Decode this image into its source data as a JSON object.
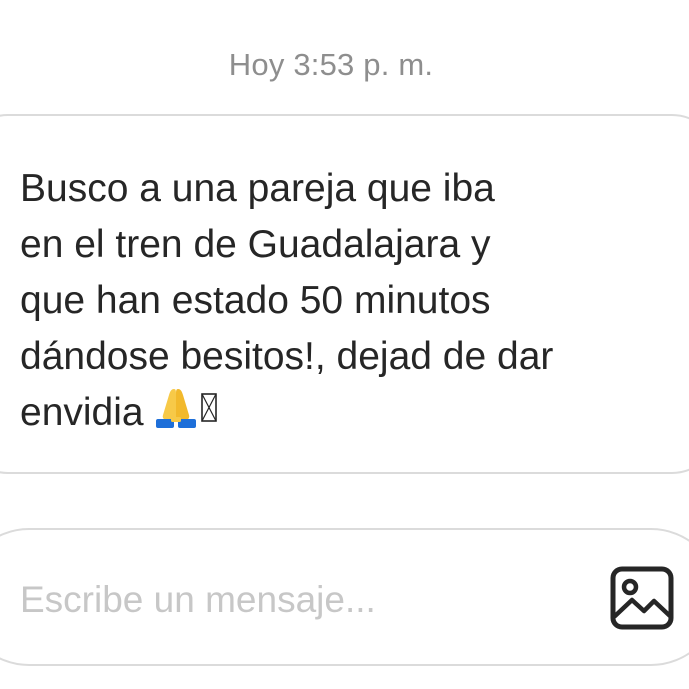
{
  "chat": {
    "timestamp": "Hoy 3:53 p. m.",
    "message": {
      "text": "Busco a una pareja que iba\nen el tren de Guadalajara y\nque han estado 50 minutos\ndándose besitos!, dejad de dar\nenvidia ",
      "emoji": "folded-hands-icon"
    }
  },
  "composer": {
    "placeholder": "Escribe un mensaje...",
    "value": "",
    "gallery_icon": "image-gallery-icon"
  }
}
